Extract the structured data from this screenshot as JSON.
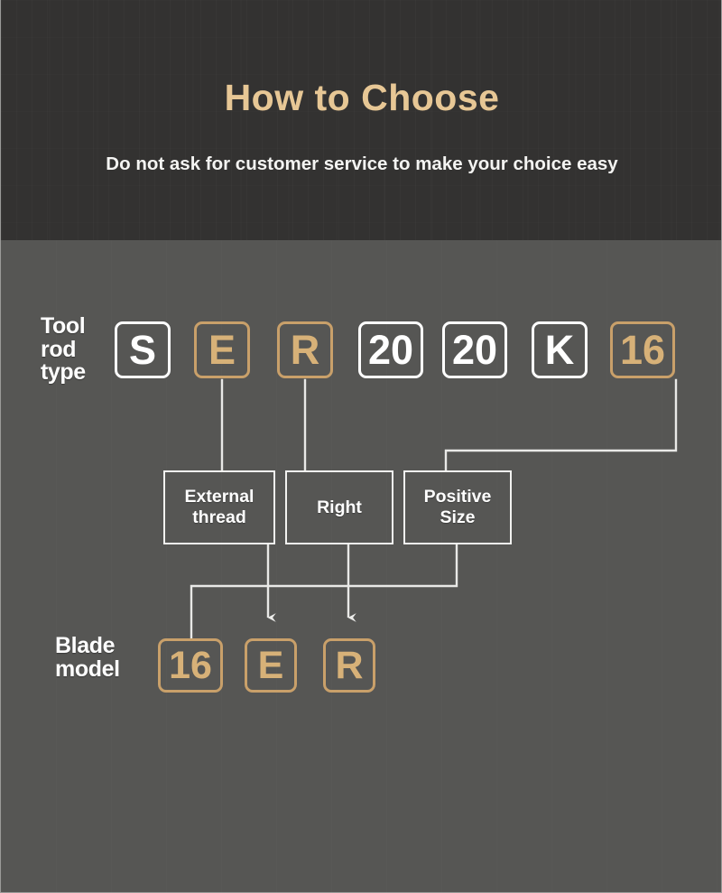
{
  "header": {
    "title": "How to Choose",
    "subtitle": "Do not ask for customer service to make your choice easy",
    "title_color": "#E7C795",
    "subtitle_color": "#F4F4F2",
    "background_color": "#333231"
  },
  "theme": {
    "body_background": "#565654",
    "gold": "#C9A06A",
    "gold_text": "#D7B178",
    "white": "#FFFFFF",
    "line_color": "#E9E9E7"
  },
  "diagram": {
    "type": "annotated-part-number-breakdown",
    "rows": [
      {
        "id": "tool-rod-type",
        "label": "Tool\nrod\ntype",
        "chips": [
          {
            "text": "S",
            "style": "white",
            "highlighted": false
          },
          {
            "text": "E",
            "style": "gold",
            "highlighted": true
          },
          {
            "text": "R",
            "style": "gold",
            "highlighted": true
          },
          {
            "text": "20",
            "style": "white",
            "highlighted": false
          },
          {
            "text": "20",
            "style": "white",
            "highlighted": false
          },
          {
            "text": "K",
            "style": "white",
            "highlighted": false
          },
          {
            "text": "16",
            "style": "gold",
            "highlighted": true
          }
        ]
      },
      {
        "id": "blade-model",
        "label": "Blade\nmodel",
        "chips": [
          {
            "text": "16",
            "style": "gold",
            "highlighted": true
          },
          {
            "text": "E",
            "style": "gold",
            "highlighted": true
          },
          {
            "text": "R",
            "style": "gold",
            "highlighted": true
          }
        ]
      }
    ],
    "explanations": [
      {
        "id": "external-thread",
        "text": "External\nthread",
        "from_chip": "E",
        "to_chip": "E"
      },
      {
        "id": "right",
        "text": "Right",
        "from_chip": "R",
        "to_chip": "R"
      },
      {
        "id": "positive-size",
        "text": "Positive\nSize",
        "from_chip": "16",
        "to_chip": "16"
      }
    ]
  }
}
